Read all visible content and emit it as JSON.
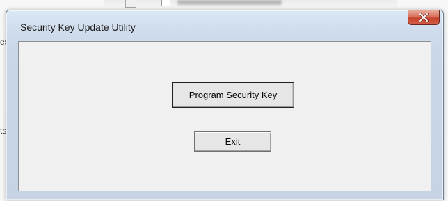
{
  "window": {
    "title": "Security Key Update Utility",
    "close_icon": "close-icon"
  },
  "buttons": {
    "program_label": "Program Security Key",
    "exit_label": "Exit"
  },
  "background": {
    "fragment_1": "es",
    "fragment_2": "ts"
  },
  "colors": {
    "title_bar": "#cfdcec",
    "client_bg": "#f0f0f0",
    "close_button": "#c5432b"
  }
}
